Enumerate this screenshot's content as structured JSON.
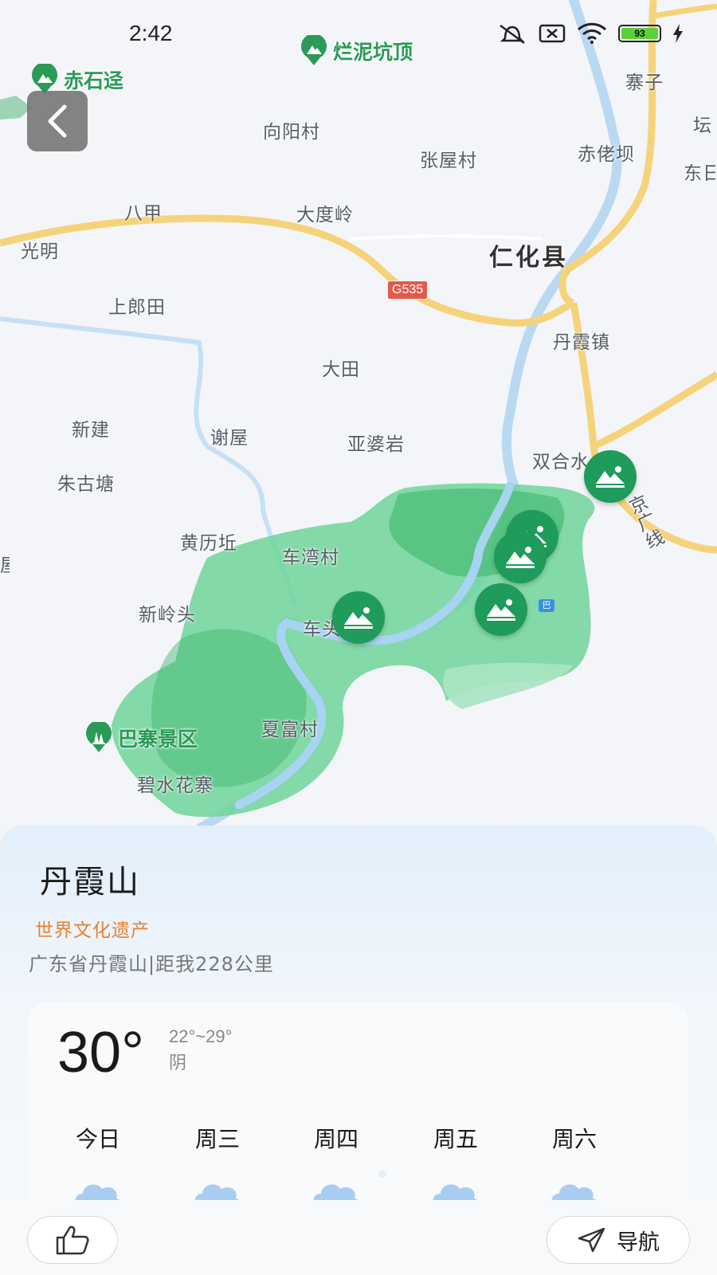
{
  "status_bar": {
    "time": "2:42",
    "battery": "93"
  },
  "map": {
    "places": [
      {
        "id": "xiangyangcun",
        "name": "向阳村"
      },
      {
        "id": "zhangwucun",
        "name": "张屋村"
      },
      {
        "id": "chilaoba",
        "name": "赤佬坝"
      },
      {
        "id": "zhaizi",
        "name": "寨子"
      },
      {
        "id": "tan",
        "name": "坛"
      },
      {
        "id": "dongri",
        "name": "东日"
      },
      {
        "id": "bajia",
        "name": "八甲"
      },
      {
        "id": "daduling",
        "name": "大度岭"
      },
      {
        "id": "guangming",
        "name": "光明"
      },
      {
        "id": "renhuaxian",
        "name": "仁化县"
      },
      {
        "id": "shanglangtian",
        "name": "上郎田"
      },
      {
        "id": "danxiazhen",
        "name": "丹霞镇"
      },
      {
        "id": "datian",
        "name": "大田"
      },
      {
        "id": "xinjian",
        "name": "新建"
      },
      {
        "id": "xiewu",
        "name": "谢屋"
      },
      {
        "id": "yapoyan",
        "name": "亚婆岩"
      },
      {
        "id": "shuanghe",
        "name": "双合水"
      },
      {
        "id": "zhuguotang",
        "name": "朱古塘"
      },
      {
        "id": "huanglikan",
        "name": "黄历坵"
      },
      {
        "id": "chewancun",
        "name": "车湾村"
      },
      {
        "id": "jingguangxian",
        "name": "京广线"
      },
      {
        "id": "xinlingtou",
        "name": "新岭头"
      },
      {
        "id": "chetou",
        "name": "车头"
      },
      {
        "id": "xiafucun",
        "name": "夏富村"
      },
      {
        "id": "bishuihuazhai",
        "name": "碧水花寨"
      },
      {
        "id": "wu",
        "name": "屋"
      }
    ],
    "road_shield": "G535",
    "pois": [
      {
        "id": "lannikengding",
        "name": "烂泥坑顶"
      },
      {
        "id": "chishijing",
        "name": "赤石迳"
      },
      {
        "id": "bazhaijingqu",
        "name": "巴寨景区"
      }
    ],
    "bus_label": "巴"
  },
  "scenic": {
    "name": "丹霞山",
    "tag": "世界文化遗产",
    "location": "广东省丹霞山|距我228公里"
  },
  "weather": {
    "temperature": "30°",
    "range": "22°~29°",
    "description": "阴",
    "forecast": [
      {
        "day": "今日",
        "icon": "cloud-icon"
      },
      {
        "day": "周三",
        "icon": "cloud-icon"
      },
      {
        "day": "周四",
        "icon": "cloud-icon"
      },
      {
        "day": "周五",
        "icon": "cloud-icon"
      },
      {
        "day": "周六",
        "icon": "cloud-icon"
      }
    ]
  },
  "actions": {
    "navigate_label": "导航"
  },
  "colors": {
    "scenic_green": "#1f9b5b",
    "area_green": "#6fd39a",
    "road_yellow": "#f5d37a",
    "river_blue": "#b9d9f3",
    "tag_orange": "#e5832f"
  }
}
